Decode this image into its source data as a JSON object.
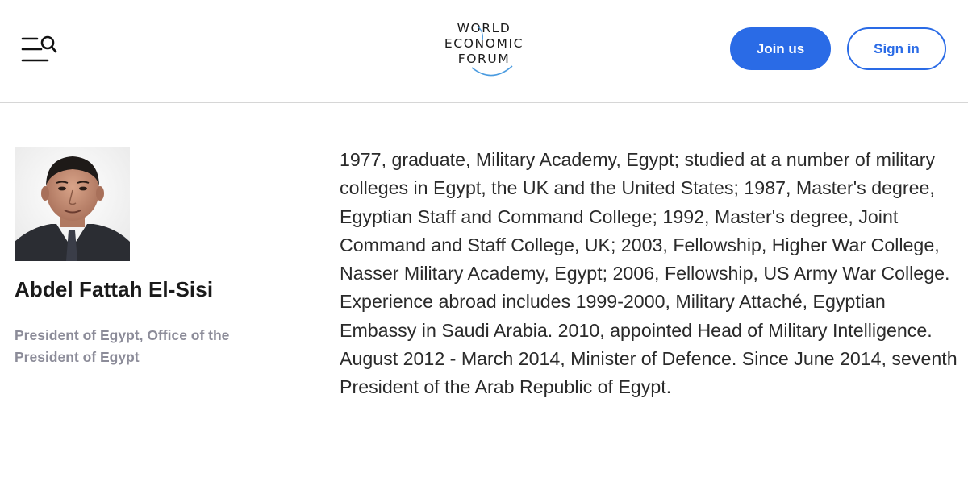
{
  "header": {
    "menu_icon": "menu-search-icon",
    "logo": {
      "line1": "WORLD",
      "line2": "ECONOMIC",
      "line3": "FORUM",
      "accent_color": "#4a9be0"
    },
    "join_label": "Join us",
    "sign_in_label": "Sign in",
    "accent_color": "#2a6be6"
  },
  "profile": {
    "name": "Abdel Fattah El-Sisi",
    "role": "President of Egypt, Office of the President of Egypt",
    "portrait_icon": "portrait-photo"
  },
  "bio": {
    "text": "1977, graduate, Military Academy, Egypt; studied at a number of military colleges in Egypt, the UK and the United States; 1987, Master's degree, Egyptian Staff and Command College; 1992, Master's degree, Joint Command and Staff College, UK; 2003, Fellowship, Higher War College, Nasser Military Academy, Egypt; 2006, Fellowship, US Army War College. Experience abroad includes 1999-2000, Military Attaché, Egyptian Embassy in Saudi Arabia. 2010, appointed Head of Military Intelligence. August 2012 - March 2014, Minister of Defence. Since June 2014, seventh President of the Arab Republic of Egypt."
  }
}
